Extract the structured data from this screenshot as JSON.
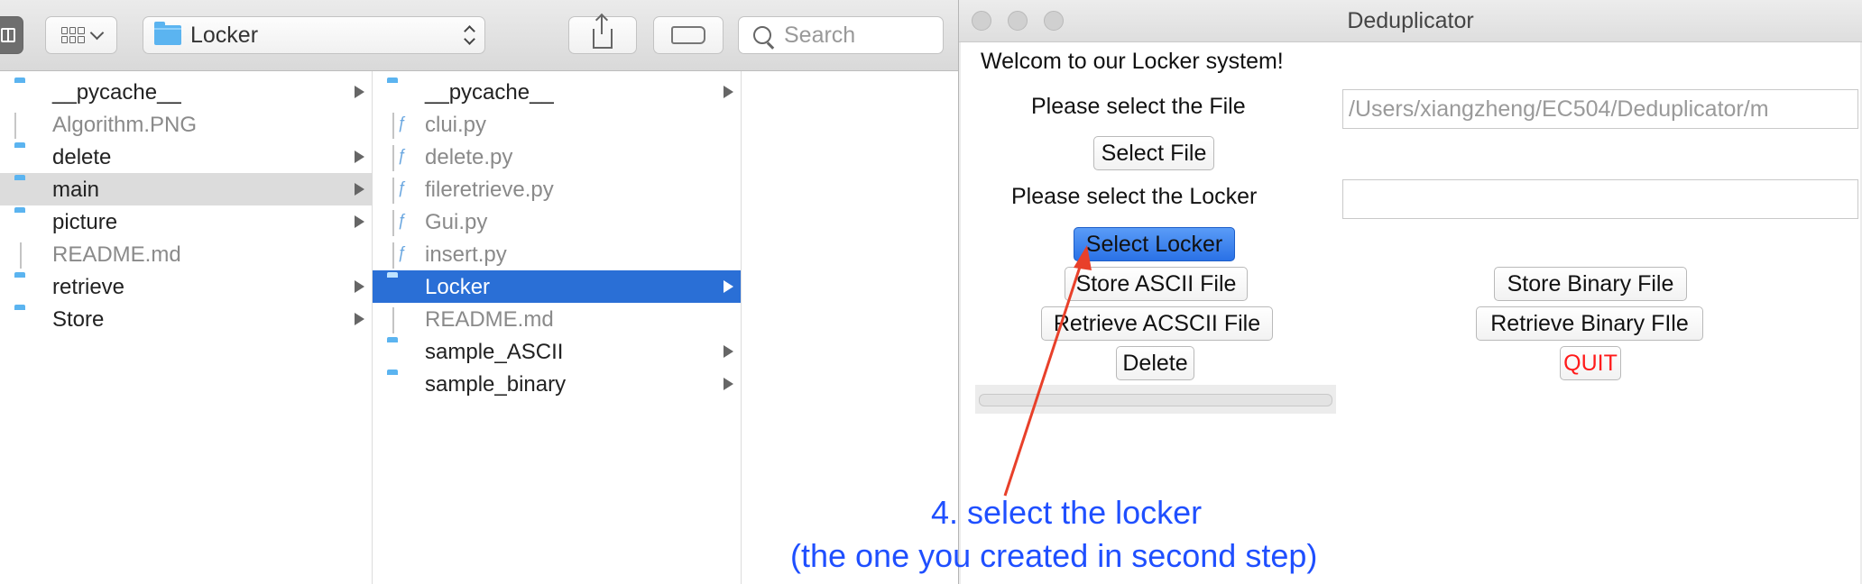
{
  "finder": {
    "path_label": "Locker",
    "search_placeholder": "Search",
    "column1": [
      {
        "label": "__pycache__",
        "kind": "folder",
        "arrow": true
      },
      {
        "label": "Algorithm.PNG",
        "kind": "image",
        "arrow": false
      },
      {
        "label": "delete",
        "kind": "folder",
        "arrow": true
      },
      {
        "label": "main",
        "kind": "folder",
        "arrow": true,
        "selected": true
      },
      {
        "label": "picture",
        "kind": "folder",
        "arrow": true
      },
      {
        "label": "README.md",
        "kind": "md",
        "arrow": false
      },
      {
        "label": "retrieve",
        "kind": "folder",
        "arrow": true
      },
      {
        "label": "Store",
        "kind": "folder",
        "arrow": true
      }
    ],
    "column2": [
      {
        "label": "__pycache__",
        "kind": "folder",
        "arrow": true
      },
      {
        "label": "clui.py",
        "kind": "py",
        "arrow": false
      },
      {
        "label": "delete.py",
        "kind": "py",
        "arrow": false
      },
      {
        "label": "fileretrieve.py",
        "kind": "py",
        "arrow": false
      },
      {
        "label": "Gui.py",
        "kind": "py",
        "arrow": false
      },
      {
        "label": "insert.py",
        "kind": "py",
        "arrow": false
      },
      {
        "label": "Locker",
        "kind": "folder",
        "arrow": true,
        "selected": true
      },
      {
        "label": "README.md",
        "kind": "md",
        "arrow": false
      },
      {
        "label": "sample_ASCII",
        "kind": "folder",
        "arrow": true
      },
      {
        "label": "sample_binary",
        "kind": "folder",
        "arrow": true
      }
    ]
  },
  "dedup": {
    "title": "Deduplicator",
    "welcome": "Welcom to our Locker system!",
    "file_label": "Please select the File",
    "file_path": "/Users/xiangzheng/EC504/Deduplicator/m",
    "select_file": "Select File",
    "locker_label": "Please select the Locker",
    "locker_path": "",
    "select_locker": "Select Locker",
    "store_ascii": "Store ASCII File",
    "store_binary": "Store Binary File",
    "retrieve_ascii": "Retrieve ACSCII File",
    "retrieve_binary": "Retrieve Binary FIle",
    "delete": "Delete",
    "quit": "QUIT",
    "progress": 0
  },
  "annotation": {
    "line1": "4. select the locker",
    "line2": "(the one you created in second step)",
    "color": "#1f4fff",
    "arrow_color": "#e8402a"
  }
}
